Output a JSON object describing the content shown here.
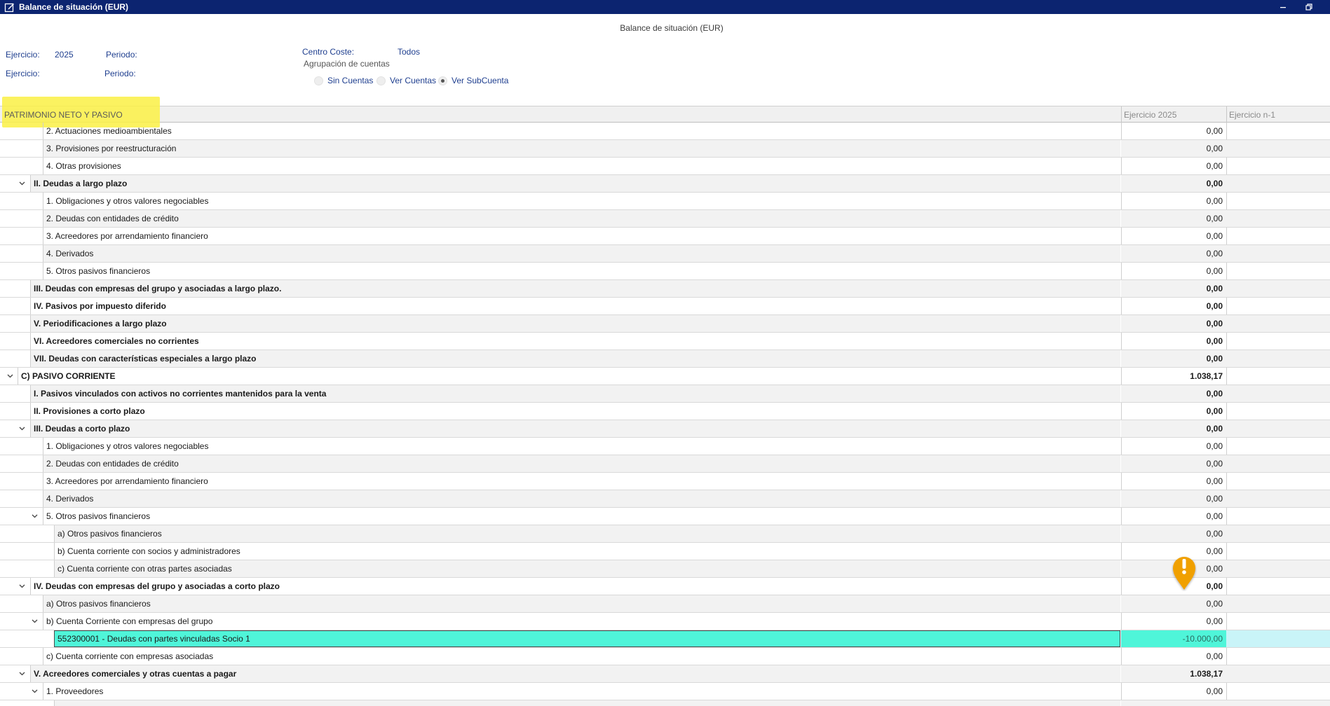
{
  "window": {
    "title": "Balance de situación (EUR)",
    "icons": {
      "app": "edit-icon",
      "minimize": "minimize-icon",
      "restore": "restore-icon"
    }
  },
  "report": {
    "title": "Balance de situación (EUR)"
  },
  "filters": {
    "ejercicio1_label": "Ejercicio:",
    "ejercicio1_value": "2025",
    "periodo1_label": "Periodo:",
    "ejercicio2_label": "Ejercicio:",
    "periodo2_label": "Periodo:",
    "centro_label": "Centro Coste:",
    "centro_value": "Todos",
    "agrupacion_label": "Agrupación de cuentas",
    "radio_options": [
      {
        "label": "Sin Cuentas",
        "selected": false
      },
      {
        "label": "Ver Cuentas",
        "selected": false
      },
      {
        "label": "Ver SubCuenta",
        "selected": true
      }
    ]
  },
  "grid": {
    "columns": {
      "name": "PATRIMONIO NETO Y PASIVO",
      "col1": "Ejercicio 2025",
      "col2": "Ejercicio n-1"
    },
    "rows": [
      {
        "label": "2. Actuaciones medioambientales",
        "value": "0,00",
        "level": 2,
        "bold": false,
        "toggle": false
      },
      {
        "label": "3. Provisiones por reestructuración",
        "value": "0,00",
        "level": 2,
        "bold": false,
        "toggle": false
      },
      {
        "label": "4. Otras provisiones",
        "value": "0,00",
        "level": 2,
        "bold": false,
        "toggle": false
      },
      {
        "label": "II. Deudas a largo plazo",
        "value": "0,00",
        "level": 1,
        "bold": true,
        "toggle": true
      },
      {
        "label": "1. Obligaciones y otros valores negociables",
        "value": "0,00",
        "level": 2,
        "bold": false,
        "toggle": false
      },
      {
        "label": "2. Deudas con entidades de crédito",
        "value": "0,00",
        "level": 2,
        "bold": false,
        "toggle": false
      },
      {
        "label": "3. Acreedores por arrendamiento financiero",
        "value": "0,00",
        "level": 2,
        "bold": false,
        "toggle": false
      },
      {
        "label": "4. Derivados",
        "value": "0,00",
        "level": 2,
        "bold": false,
        "toggle": false
      },
      {
        "label": "5. Otros pasivos financieros",
        "value": "0,00",
        "level": 2,
        "bold": false,
        "toggle": false
      },
      {
        "label": "III. Deudas con empresas del grupo y asociadas a largo plazo.",
        "value": "0,00",
        "level": 1,
        "bold": true,
        "toggle": false
      },
      {
        "label": "IV. Pasivos por impuesto diferido",
        "value": "0,00",
        "level": 1,
        "bold": true,
        "toggle": false
      },
      {
        "label": "V. Periodificaciones a largo plazo",
        "value": "0,00",
        "level": 1,
        "bold": true,
        "toggle": false
      },
      {
        "label": "VI. Acreedores comerciales no corrientes",
        "value": "0,00",
        "level": 1,
        "bold": true,
        "toggle": false
      },
      {
        "label": "VII. Deudas con características especiales a largo plazo",
        "value": "0,00",
        "level": 1,
        "bold": true,
        "toggle": false
      },
      {
        "label": "C) PASIVO CORRIENTE",
        "value": "1.038,17",
        "level": 0,
        "bold": true,
        "toggle": true
      },
      {
        "label": "I. Pasivos vinculados con activos no corrientes mantenidos para la venta",
        "value": "0,00",
        "level": 1,
        "bold": true,
        "toggle": false
      },
      {
        "label": "II. Provisiones a corto plazo",
        "value": "0,00",
        "level": 1,
        "bold": true,
        "toggle": false
      },
      {
        "label": "III. Deudas a corto plazo",
        "value": "0,00",
        "level": 1,
        "bold": true,
        "toggle": true
      },
      {
        "label": "1. Obligaciones y otros valores negociables",
        "value": "0,00",
        "level": 2,
        "bold": false,
        "toggle": false
      },
      {
        "label": "2. Deudas con entidades de crédito",
        "value": "0,00",
        "level": 2,
        "bold": false,
        "toggle": false
      },
      {
        "label": "3. Acreedores por arrendamiento financiero",
        "value": "0,00",
        "level": 2,
        "bold": false,
        "toggle": false
      },
      {
        "label": "4. Derivados",
        "value": "0,00",
        "level": 2,
        "bold": false,
        "toggle": false
      },
      {
        "label": "5. Otros pasivos financieros",
        "value": "0,00",
        "level": 2,
        "bold": false,
        "toggle": true
      },
      {
        "label": "a) Otros pasivos financieros",
        "value": "0,00",
        "level": 3,
        "bold": false,
        "toggle": false
      },
      {
        "label": "b) Cuenta corriente con socios y administradores",
        "value": "0,00",
        "level": 3,
        "bold": false,
        "toggle": false
      },
      {
        "label": "c) Cuenta corriente con otras partes asociadas",
        "value": "0,00",
        "level": 3,
        "bold": false,
        "toggle": false
      },
      {
        "label": "IV. Deudas con empresas del grupo y asociadas a corto plazo",
        "value": "0,00",
        "level": 1,
        "bold": true,
        "toggle": true
      },
      {
        "label": "a) Otros pasivos financieros",
        "value": "0,00",
        "level": 2,
        "bold": false,
        "toggle": false
      },
      {
        "label": "b) Cuenta Corriente con empresas del grupo",
        "value": "0,00",
        "level": 2,
        "bold": false,
        "toggle": true
      },
      {
        "label": "552300001 - Deudas con partes vinculadas Socio 1",
        "value": "-10.000,00",
        "level": 3,
        "bold": false,
        "toggle": false,
        "selected": true
      },
      {
        "label": "c) Cuenta corriente con empresas asociadas",
        "value": "0,00",
        "level": 2,
        "bold": false,
        "toggle": false
      },
      {
        "label": "V. Acreedores comerciales y otras cuentas a pagar",
        "value": "1.038,17",
        "level": 1,
        "bold": true,
        "toggle": true
      },
      {
        "label": "1. Proveedores",
        "value": "0,00",
        "level": 2,
        "bold": false,
        "toggle": true
      },
      {
        "label": "",
        "value": "",
        "level": 3,
        "bold": false,
        "toggle": false
      }
    ]
  },
  "colors": {
    "titlebar": "#0c2470",
    "highlight": "#fbf04a",
    "selected_row": "#4ff5d9",
    "warning_pin": "#f0a000"
  },
  "markers": {
    "warning": "warning-pin-icon"
  }
}
